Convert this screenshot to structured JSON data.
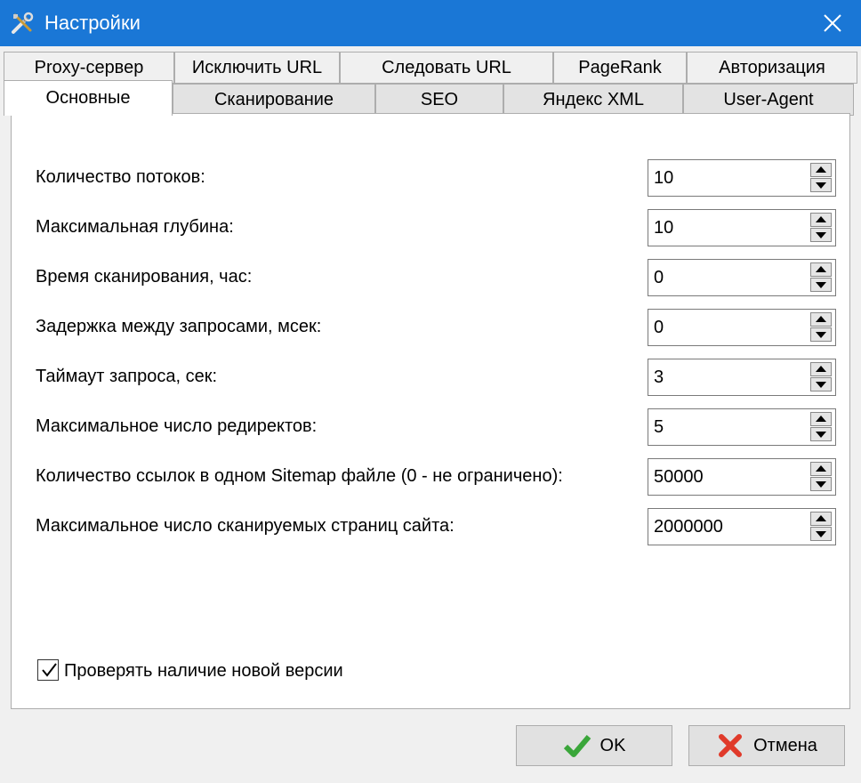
{
  "window": {
    "title": "Настройки",
    "title_icon": "tools-icon",
    "close_icon": "close-icon"
  },
  "tabs": {
    "row1": [
      "Proxy-сервер",
      "Исключить URL",
      "Следовать URL",
      "PageRank",
      "Авторизация"
    ],
    "row2": [
      "Основные",
      "Сканирование",
      "SEO",
      "Яндекс XML",
      "User-Agent"
    ],
    "active": "Основные"
  },
  "fields": [
    {
      "label": "Количество потоков:",
      "value": "10"
    },
    {
      "label": "Максимальная глубина:",
      "value": "10"
    },
    {
      "label": "Время сканирования, час:",
      "value": "0"
    },
    {
      "label": "Задержка между запросами, мсек:",
      "value": "0"
    },
    {
      "label": "Таймаут запроса, сек:",
      "value": "3"
    },
    {
      "label": "Максимальное число редиректов:",
      "value": "5"
    },
    {
      "label": "Количество ссылок в одном Sitemap файле (0 - не ограничено):",
      "value": "50000"
    },
    {
      "label": "Максимальное число сканируемых страниц сайта:",
      "value": "2000000"
    }
  ],
  "check_updates": {
    "label": "Проверять наличие новой версии",
    "checked": true
  },
  "buttons": {
    "ok": "OK",
    "cancel": "Отмена"
  },
  "colors": {
    "titlebar": "#1a77d6",
    "ok_check": "#3aa63a",
    "cancel_x": "#e03a2a"
  }
}
